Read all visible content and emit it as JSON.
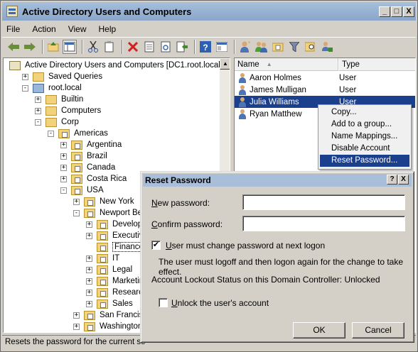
{
  "window": {
    "title": "Active Directory Users and Computers",
    "min": "_",
    "max": "□",
    "close": "X"
  },
  "menu": [
    "File",
    "Action",
    "View",
    "Help"
  ],
  "toolbar": [
    "back-icon",
    "forward-icon",
    "up-folder-icon",
    "show-tree-icon",
    "cut-icon",
    "copy-icon",
    "delete-icon",
    "properties-icon",
    "refresh-icon",
    "export-icon",
    "help-icon",
    "console-icon",
    "new-user-icon",
    "new-group-icon",
    "new-ou-icon",
    "filter-icon",
    "find-icon",
    "delegate-icon"
  ],
  "tree": {
    "root": "Active Directory Users and Computers [DC1.root.local]",
    "items": [
      {
        "label": "Saved Queries",
        "exp": "+"
      },
      {
        "label": "root.local",
        "exp": "-"
      },
      {
        "label": "Builtin",
        "exp": "+"
      },
      {
        "label": "Computers",
        "exp": "+"
      },
      {
        "label": "Corp",
        "exp": "-"
      },
      {
        "label": "Americas",
        "exp": "-"
      },
      {
        "label": "Argentina",
        "exp": "+"
      },
      {
        "label": "Brazil",
        "exp": "+"
      },
      {
        "label": "Canada",
        "exp": "+"
      },
      {
        "label": "Costa Rica",
        "exp": "+"
      },
      {
        "label": "USA",
        "exp": "-"
      },
      {
        "label": "New York",
        "exp": "+"
      },
      {
        "label": "Newport Beach",
        "exp": "-"
      },
      {
        "label": "Developme",
        "exp": "+"
      },
      {
        "label": "Executive",
        "exp": "+"
      },
      {
        "label": "Finance",
        "exp": ""
      },
      {
        "label": "IT",
        "exp": "+"
      },
      {
        "label": "Legal",
        "exp": "+"
      },
      {
        "label": "Marketing",
        "exp": "+"
      },
      {
        "label": "Research",
        "exp": "+"
      },
      {
        "label": "Sales",
        "exp": "+"
      },
      {
        "label": "San Francisco",
        "exp": "+"
      },
      {
        "label": "Washington, D",
        "exp": "+"
      }
    ]
  },
  "list": {
    "columns": [
      "Name",
      "Type"
    ],
    "rows": [
      {
        "name": "Aaron Holmes",
        "type": "User"
      },
      {
        "name": "James Mulligan",
        "type": "User"
      },
      {
        "name": "Julia Williams",
        "type": "User"
      },
      {
        "name": "Ryan Matthew",
        "type": ""
      }
    ]
  },
  "context_menu": [
    "Copy...",
    "Add to a group...",
    "Name Mappings...",
    "Disable Account",
    "Reset Password..."
  ],
  "dialog": {
    "title": "Reset Password",
    "help": "?",
    "close": "X",
    "new_password_label": "New password:",
    "confirm_password_label": "Confirm password:",
    "must_change_label": "User must change password at next logon",
    "must_change_checked": "✔",
    "logoff_note": "The user must logoff and then logon again for the change to take effect.",
    "lockout_status": "Account Lockout Status on this Domain Controller: Unlocked",
    "unlock_label": "Unlock the user's account",
    "ok": "OK",
    "cancel": "Cancel"
  },
  "status": "Resets the password for the current se"
}
